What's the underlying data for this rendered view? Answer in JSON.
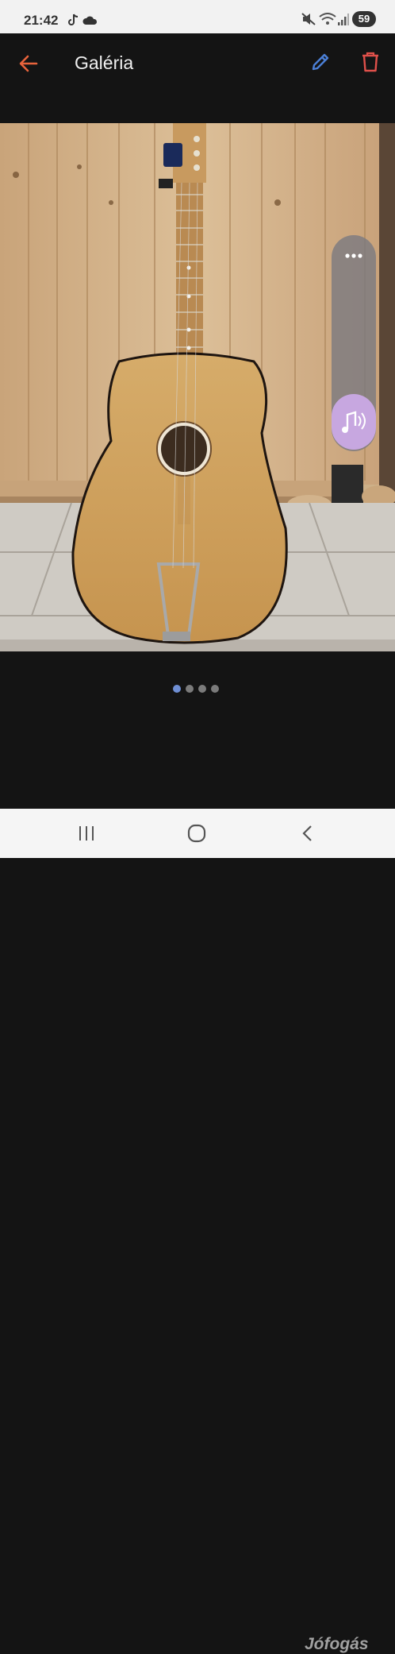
{
  "status_bar": {
    "time": "21:42",
    "battery": "59"
  },
  "app_bar": {
    "title": "Galéria"
  },
  "pager": {
    "count": 4,
    "active": 0
  },
  "watermark": "Jófogás",
  "colors": {
    "accent": "#e8643c",
    "edit": "#4b7fd6",
    "delete": "#e0504a",
    "dot_active": "#6f8fd4"
  }
}
